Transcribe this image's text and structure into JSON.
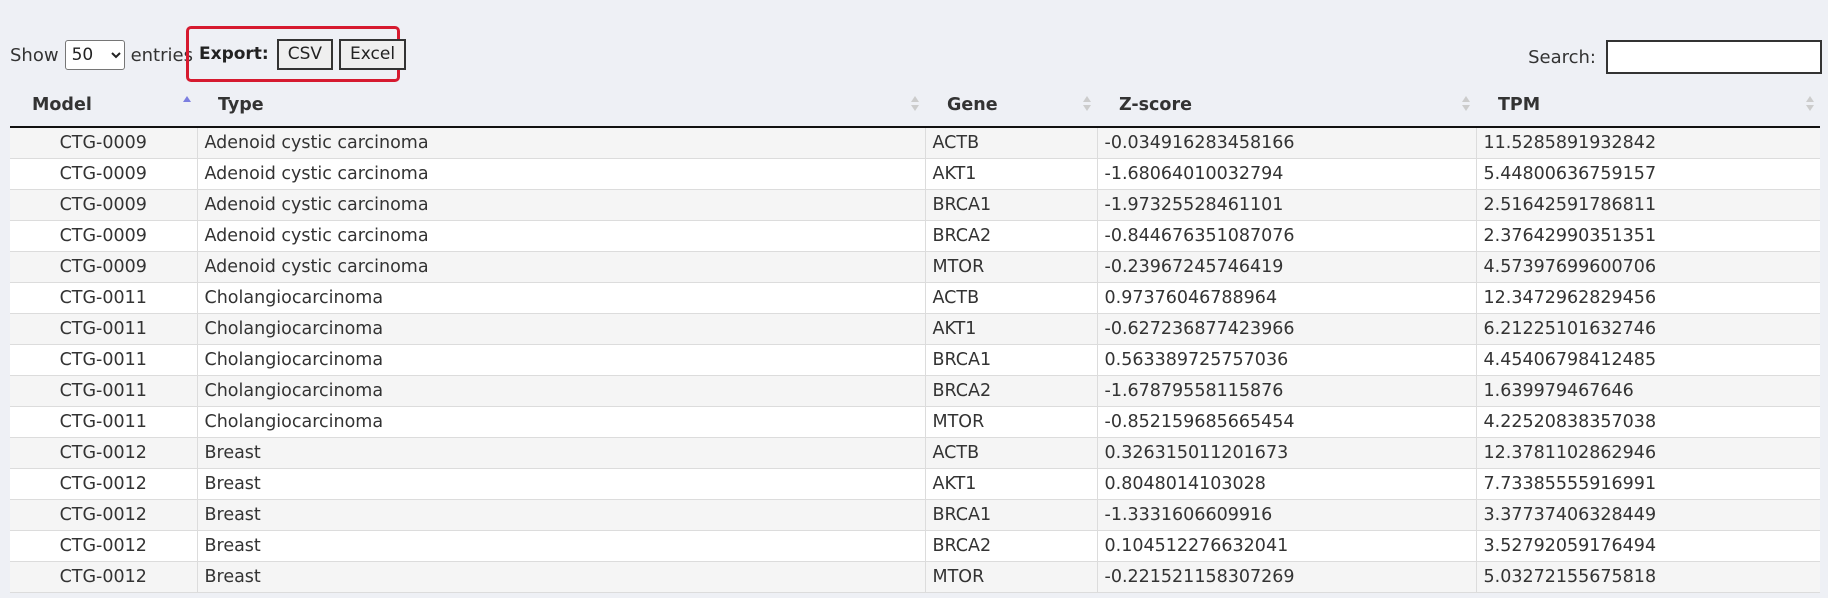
{
  "length": {
    "show_label": "Show",
    "selected": "50",
    "entries_label": "entries"
  },
  "export": {
    "label": "Export:",
    "csv": "CSV",
    "excel": "Excel"
  },
  "search": {
    "label": "Search:",
    "value": ""
  },
  "table": {
    "columns": [
      "Model",
      "Type",
      "Gene",
      "Z-score",
      "TPM"
    ],
    "sorted_column": "Model",
    "rows": [
      [
        "CTG-0009",
        "Adenoid cystic carcinoma",
        "ACTB",
        "-0.034916283458166",
        "11.5285891932842"
      ],
      [
        "CTG-0009",
        "Adenoid cystic carcinoma",
        "AKT1",
        "-1.68064010032794",
        "5.44800636759157"
      ],
      [
        "CTG-0009",
        "Adenoid cystic carcinoma",
        "BRCA1",
        "-1.97325528461101",
        "2.51642591786811"
      ],
      [
        "CTG-0009",
        "Adenoid cystic carcinoma",
        "BRCA2",
        "-0.844676351087076",
        "2.37642990351351"
      ],
      [
        "CTG-0009",
        "Adenoid cystic carcinoma",
        "MTOR",
        "-0.23967245746419",
        "4.57397699600706"
      ],
      [
        "CTG-0011",
        "Cholangiocarcinoma",
        "ACTB",
        "0.97376046788964",
        "12.3472962829456"
      ],
      [
        "CTG-0011",
        "Cholangiocarcinoma",
        "AKT1",
        "-0.627236877423966",
        "6.21225101632746"
      ],
      [
        "CTG-0011",
        "Cholangiocarcinoma",
        "BRCA1",
        "0.563389725757036",
        "4.45406798412485"
      ],
      [
        "CTG-0011",
        "Cholangiocarcinoma",
        "BRCA2",
        "-1.67879558115876",
        "1.639979467646"
      ],
      [
        "CTG-0011",
        "Cholangiocarcinoma",
        "MTOR",
        "-0.852159685665454",
        "4.22520838357038"
      ],
      [
        "CTG-0012",
        "Breast",
        "ACTB",
        "0.326315011201673",
        "12.3781102862946"
      ],
      [
        "CTG-0012",
        "Breast",
        "AKT1",
        "0.8048014103028",
        "7.73385555916991"
      ],
      [
        "CTG-0012",
        "Breast",
        "BRCA1",
        "-1.3331606609916",
        "3.37737406328449"
      ],
      [
        "CTG-0012",
        "Breast",
        "BRCA2",
        "0.104512276632041",
        "3.52792059176494"
      ],
      [
        "CTG-0012",
        "Breast",
        "MTOR",
        "-0.221521158307269",
        "5.03272155675818"
      ]
    ]
  },
  "colors": {
    "highlight_border": "#d61a2f",
    "sort_active": "#7b7ee0"
  }
}
